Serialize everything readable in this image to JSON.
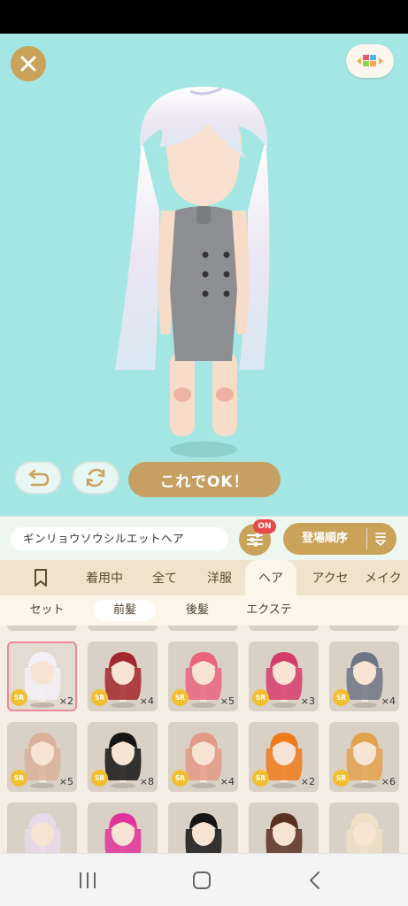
{
  "colors": {
    "stage_bg": "#a4e6e3",
    "gold": "#c9a35a",
    "tab_bg": "#f0e2cd",
    "grid_bg": "#f4eee5",
    "badge_red": "#e84a4a",
    "sr_yellow": "#f2bf2f"
  },
  "stage": {
    "close_icon": "close-icon",
    "menu_icon": "color-blocks-icon",
    "undo_icon": "undo-icon",
    "rotate_icon": "rotate-icon",
    "ok_label": "これでOK！"
  },
  "info": {
    "item_name": "ギンリョウソウシルエットヘア",
    "filter_badge": "ON",
    "sort_label": "登場順序"
  },
  "tabs": [
    {
      "label": "着用中"
    },
    {
      "label": "全て"
    },
    {
      "label": "洋服"
    },
    {
      "label": "ヘア"
    },
    {
      "label": "アクセ"
    },
    {
      "label": "メイク"
    }
  ],
  "subtabs": [
    {
      "label": "セット"
    },
    {
      "label": "前髪"
    },
    {
      "label": "後髪"
    },
    {
      "label": "エクステ"
    }
  ],
  "items": [
    {
      "hair": "#f3f0f6",
      "rarity": "SR",
      "count": "×2"
    },
    {
      "hair": "#a3282e",
      "rarity": "SR",
      "count": "×4"
    },
    {
      "hair": "#e9647c",
      "rarity": "SR",
      "count": "×5"
    },
    {
      "hair": "#d63c6a",
      "rarity": "SR",
      "count": "×3"
    },
    {
      "hair": "#6f7585",
      "rarity": "SR",
      "count": "×4"
    },
    {
      "hair": "#d9b09a",
      "rarity": "SR",
      "count": "×5"
    },
    {
      "hair": "#151515",
      "rarity": "SR",
      "count": "×8"
    },
    {
      "hair": "#e29a86",
      "rarity": "SR",
      "count": "×4"
    },
    {
      "hair": "#ee7a1a",
      "rarity": "SR",
      "count": "×2"
    },
    {
      "hair": "#e0a24c",
      "rarity": "SR",
      "count": "×6"
    },
    {
      "hair": "#ead9e8",
      "rarity": "",
      "count": ""
    },
    {
      "hair": "#e1339a",
      "rarity": "",
      "count": ""
    },
    {
      "hair": "#161616",
      "rarity": "",
      "count": ""
    },
    {
      "hair": "#5a3022",
      "rarity": "",
      "count": ""
    },
    {
      "hair": "#efe0c6",
      "rarity": "",
      "count": ""
    }
  ],
  "nav": {
    "recents_icon": "recents-icon",
    "home_icon": "home-icon",
    "back_icon": "back-icon"
  }
}
